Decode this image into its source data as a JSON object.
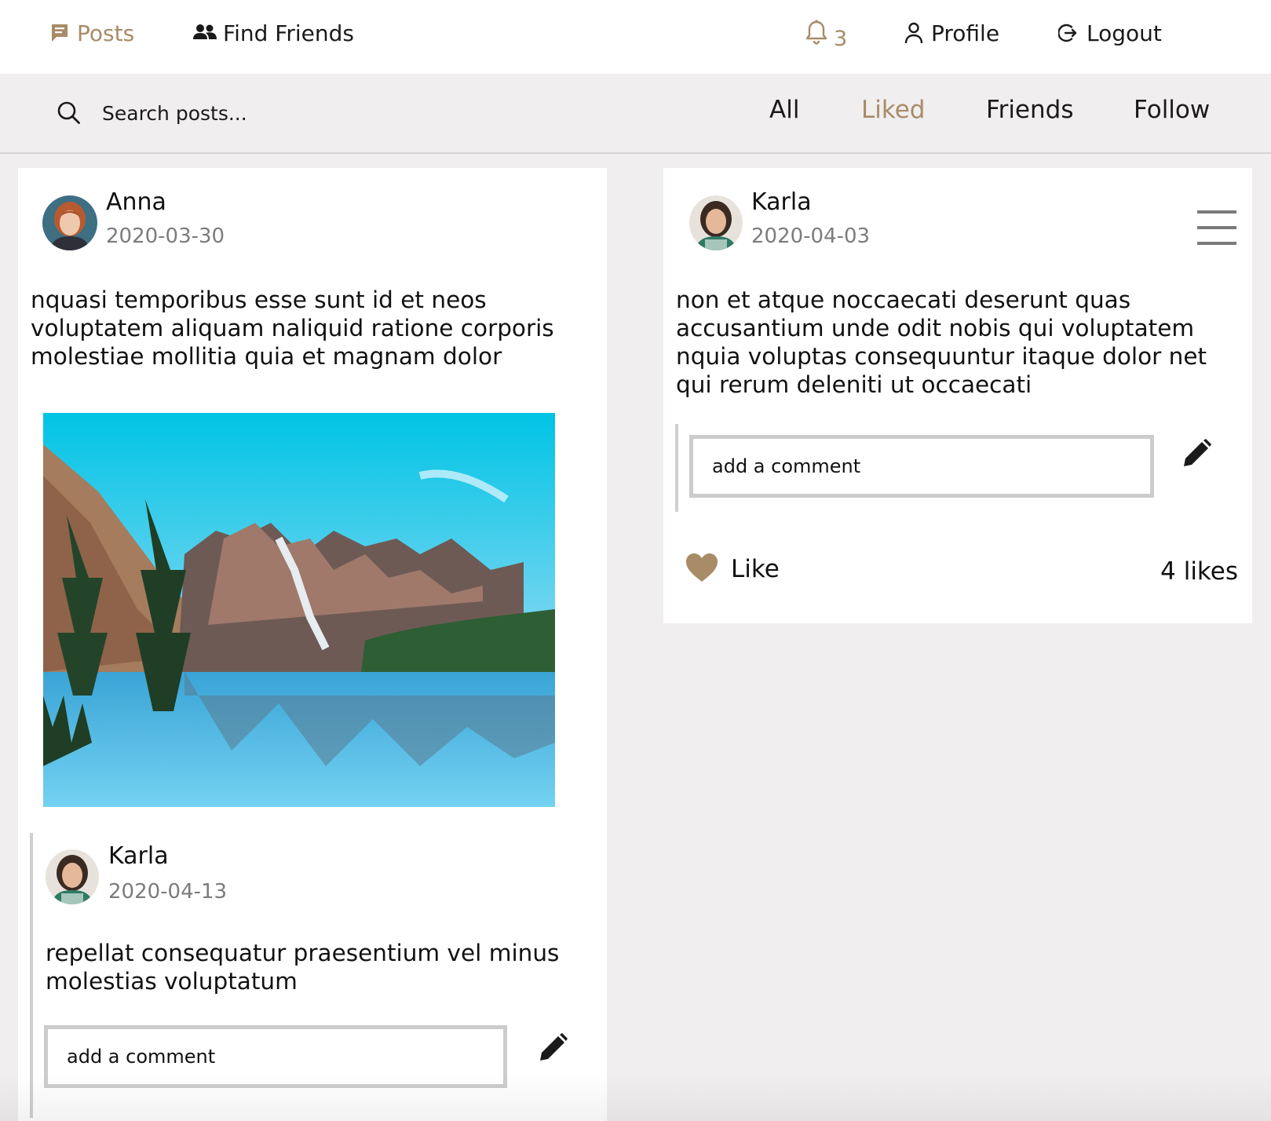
{
  "nav": {
    "posts_label": "Posts",
    "find_friends_label": "Find Friends",
    "notification_count": "3",
    "profile_label": "Profile",
    "logout_label": "Logout"
  },
  "filters": {
    "search_placeholder": "Search posts...",
    "tabs": [
      "All",
      "Liked",
      "Friends",
      "Follow"
    ],
    "active_tab": "Liked"
  },
  "posts": [
    {
      "author": "Anna",
      "date": "2020-03-30",
      "text": "nquasi temporibus esse sunt id et neos voluptatem aliquam naliquid ratione corporis molestiae mollitia quia et magnam dolor",
      "image": "mountain-lake-photo",
      "comments": [
        {
          "author": "Karla",
          "date": "2020-04-13",
          "text": "repellat consequatur praesentium vel minus molestias voluptatum"
        }
      ],
      "comment_placeholder": "add a comment"
    },
    {
      "author": "Karla",
      "date": "2020-04-03",
      "text": "non et atque noccaecati deserunt quas accusantium unde odit nobis qui voluptatem nquia voluptas consequuntur itaque dolor net qui rerum deleniti ut occaecati",
      "comment_placeholder": "add a comment",
      "like_label": "Like",
      "likes_count": "4 likes"
    }
  ],
  "colors": {
    "accent": "#a88b67",
    "background": "#f0eeee",
    "card": "#ffffff",
    "muted_text": "#7c7c7c"
  },
  "icons": [
    "posts-icon",
    "friends-icon",
    "bell-icon",
    "profile-icon",
    "logout-icon",
    "search-icon",
    "menu-icon",
    "pencil-icon",
    "heart-icon"
  ]
}
